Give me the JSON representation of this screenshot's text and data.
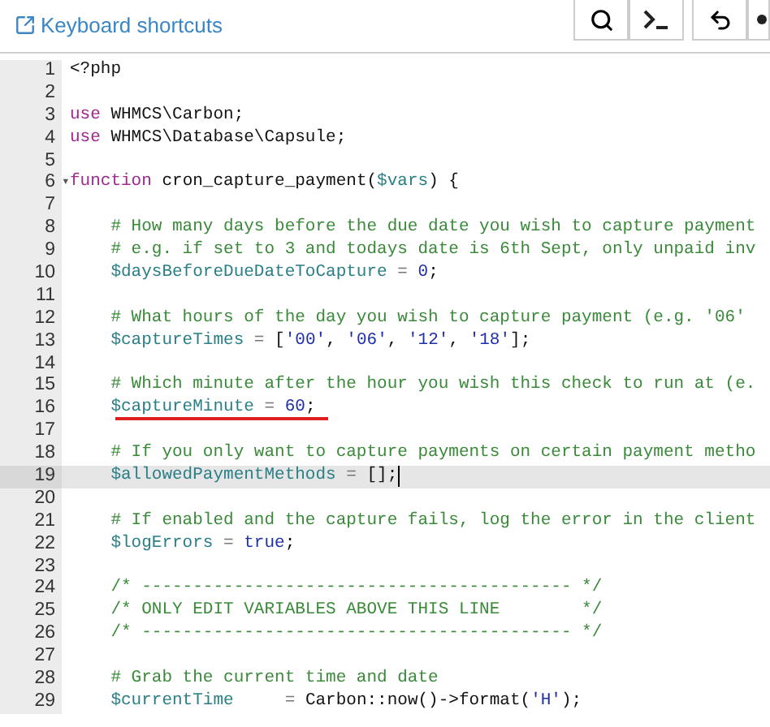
{
  "toolbar": {
    "link": "Keyboard shortcuts",
    "buttons": [
      {
        "kind": "search"
      },
      {
        "kind": "terminal"
      },
      {
        "kind": "undo"
      },
      {
        "kind": "partial"
      }
    ]
  },
  "lines": [
    {
      "number": "1",
      "active": false,
      "cursor": false,
      "underlined": false,
      "tokens": [
        {
          "kind": "plain",
          "text": "<?php"
        }
      ]
    },
    {
      "number": "2",
      "active": false,
      "cursor": false,
      "underlined": false
    },
    {
      "number": "3",
      "active": false,
      "cursor": false,
      "underlined": false,
      "tokens": [
        {
          "kind": "keyword",
          "text": "use"
        },
        {
          "kind": "plain",
          "text": " WHMCS\\Carbon;"
        }
      ]
    },
    {
      "number": "4",
      "active": false,
      "cursor": false,
      "underlined": false,
      "tokens": [
        {
          "kind": "keyword",
          "text": "use"
        },
        {
          "kind": "plain",
          "text": " WHMCS\\Database\\Capsule;"
        }
      ]
    },
    {
      "number": "5",
      "active": false,
      "cursor": false,
      "underlined": false
    },
    {
      "number": "6",
      "fold_marker": "▾",
      "active": false,
      "cursor": false,
      "underlined": false,
      "tokens": [
        {
          "kind": "keyword",
          "text": "function"
        },
        {
          "kind": "plain",
          "text": " cron_capture_payment("
        },
        {
          "kind": "variable",
          "text": "$vars"
        },
        {
          "kind": "plain",
          "text": ") {"
        }
      ]
    },
    {
      "number": "7",
      "active": false,
      "cursor": false,
      "underlined": false
    },
    {
      "number": "8",
      "active": false,
      "cursor": false,
      "underlined": false,
      "tokens": [
        {
          "kind": "comment",
          "text": "    # How many days before the due date you wish to capture payment"
        }
      ]
    },
    {
      "number": "9",
      "active": false,
      "cursor": false,
      "underlined": false,
      "tokens": [
        {
          "kind": "comment",
          "text": "    # e.g. if set to 3 and todays date is 6th Sept, only unpaid inv"
        }
      ]
    },
    {
      "number": "10",
      "active": false,
      "cursor": false,
      "underlined": false,
      "tokens": [
        {
          "kind": "variable",
          "text": "    $daysBeforeDueDateToCapture"
        },
        {
          "kind": "operator",
          "text": " = "
        },
        {
          "kind": "number",
          "text": "0"
        },
        {
          "kind": "plain",
          "text": ";"
        }
      ]
    },
    {
      "number": "11",
      "active": false,
      "cursor": false,
      "underlined": false
    },
    {
      "number": "12",
      "active": false,
      "cursor": false,
      "underlined": false,
      "tokens": [
        {
          "kind": "comment",
          "text": "    # What hours of the day you wish to capture payment (e.g. '06'"
        }
      ]
    },
    {
      "number": "13",
      "active": false,
      "cursor": false,
      "underlined": false,
      "tokens": [
        {
          "kind": "variable",
          "text": "    $captureTimes"
        },
        {
          "kind": "operator",
          "text": " = "
        },
        {
          "kind": "plain",
          "text": "["
        },
        {
          "kind": "string",
          "text": "'00'"
        },
        {
          "kind": "plain",
          "text": ", "
        },
        {
          "kind": "string",
          "text": "'06'"
        },
        {
          "kind": "plain",
          "text": ", "
        },
        {
          "kind": "string",
          "text": "'12'"
        },
        {
          "kind": "plain",
          "text": ", "
        },
        {
          "kind": "string",
          "text": "'18'"
        },
        {
          "kind": "plain",
          "text": "];"
        }
      ]
    },
    {
      "number": "14",
      "active": false,
      "cursor": false,
      "underlined": false
    },
    {
      "number": "15",
      "active": false,
      "cursor": false,
      "underlined": false,
      "tokens": [
        {
          "kind": "comment",
          "text": "    # Which minute after the hour you wish this check to run at (e."
        }
      ]
    },
    {
      "number": "16",
      "active": false,
      "cursor": false,
      "underlined": true,
      "tokens": [
        {
          "kind": "variable",
          "text": "    $captureMinute"
        },
        {
          "kind": "operator",
          "text": " = "
        },
        {
          "kind": "number",
          "text": "60"
        },
        {
          "kind": "plain",
          "text": ";"
        }
      ]
    },
    {
      "number": "17",
      "active": false,
      "cursor": false,
      "underlined": false
    },
    {
      "number": "18",
      "active": false,
      "cursor": false,
      "underlined": false,
      "tokens": [
        {
          "kind": "comment",
          "text": "    # If you only want to capture payments on certain payment metho"
        }
      ]
    },
    {
      "number": "19",
      "active": true,
      "cursor": true,
      "underlined": false,
      "tokens": [
        {
          "kind": "variable",
          "text": "    $allowedPaymentMethods"
        },
        {
          "kind": "operator",
          "text": " = "
        },
        {
          "kind": "plain",
          "text": "[];"
        }
      ]
    },
    {
      "number": "20",
      "active": false,
      "cursor": false,
      "underlined": false
    },
    {
      "number": "21",
      "active": false,
      "cursor": false,
      "underlined": false,
      "tokens": [
        {
          "kind": "comment",
          "text": "    # If enabled and the capture fails, log the error in the client"
        }
      ]
    },
    {
      "number": "22",
      "active": false,
      "cursor": false,
      "underlined": false,
      "tokens": [
        {
          "kind": "variable",
          "text": "    $logErrors"
        },
        {
          "kind": "operator",
          "text": " = "
        },
        {
          "kind": "number",
          "text": "true"
        },
        {
          "kind": "plain",
          "text": ";"
        }
      ]
    },
    {
      "number": "23",
      "active": false,
      "cursor": false,
      "underlined": false
    },
    {
      "number": "24",
      "active": false,
      "cursor": false,
      "underlined": false,
      "tokens": [
        {
          "kind": "comment",
          "text": "    /* ------------------------------------------ */"
        }
      ]
    },
    {
      "number": "25",
      "active": false,
      "cursor": false,
      "underlined": false,
      "tokens": [
        {
          "kind": "comment",
          "text": "    /* ONLY EDIT VARIABLES ABOVE THIS LINE        */"
        }
      ]
    },
    {
      "number": "26",
      "active": false,
      "cursor": false,
      "underlined": false,
      "tokens": [
        {
          "kind": "comment",
          "text": "    /* ------------------------------------------ */"
        }
      ]
    },
    {
      "number": "27",
      "active": false,
      "cursor": false,
      "underlined": false
    },
    {
      "number": "28",
      "active": false,
      "cursor": false,
      "underlined": false,
      "tokens": [
        {
          "kind": "comment",
          "text": "    # Grab the current time and date"
        }
      ]
    },
    {
      "number": "29",
      "active": false,
      "cursor": false,
      "underlined": false,
      "tokens": [
        {
          "kind": "variable",
          "text": "    $currentTime"
        },
        {
          "kind": "operator",
          "text": "     = "
        },
        {
          "kind": "plain",
          "text": "Carbon::now()->format("
        },
        {
          "kind": "string",
          "text": "'H'"
        },
        {
          "kind": "plain",
          "text": ");"
        }
      ]
    }
  ]
}
